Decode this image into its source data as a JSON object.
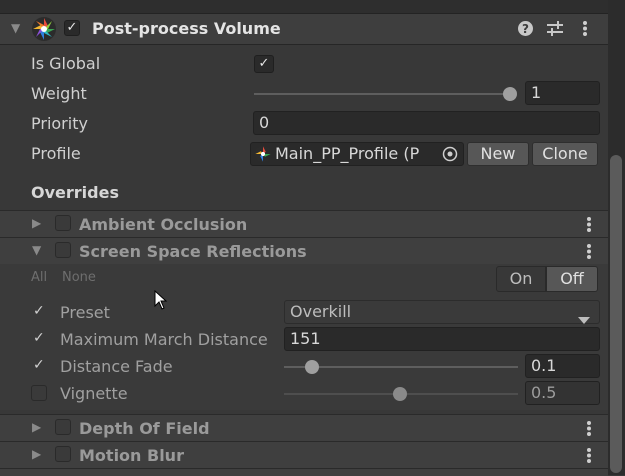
{
  "component": {
    "title": "Post-process Volume",
    "enabled": true,
    "fold_icon": "triangle-down-icon",
    "icon": "post-process-aperture-icon",
    "help_icon": "help-icon",
    "presets_icon": "sliders-icon",
    "menu_icon": "kebab-menu-icon"
  },
  "properties": {
    "is_global": {
      "label": "Is Global",
      "checked": true
    },
    "weight": {
      "label": "Weight",
      "value": "1",
      "level": 1.0
    },
    "priority": {
      "label": "Priority",
      "value": "0"
    },
    "profile": {
      "label": "Profile",
      "value": "Main_PP_Profile (P",
      "new_label": "New",
      "clone_label": "Clone"
    }
  },
  "overrides": {
    "heading": "Overrides",
    "effects": [
      {
        "name": "Ambient Occlusion",
        "expanded": false,
        "enabled": false
      },
      {
        "name": "Screen Space Reflections",
        "expanded": true,
        "enabled": false
      },
      {
        "name": "Depth Of Field",
        "expanded": false,
        "enabled": false
      },
      {
        "name": "Motion Blur",
        "expanded": false,
        "enabled": false
      }
    ]
  },
  "ssr": {
    "all_label": "All",
    "none_label": "None",
    "on_label": "On",
    "off_label": "Off",
    "preset": {
      "label": "Preset",
      "value": "Overkill",
      "override": true
    },
    "max_march": {
      "label": "Maximum March Distance",
      "value": "151",
      "override": true
    },
    "distance_fade": {
      "label": "Distance Fade",
      "value": "0.1",
      "override": true,
      "level": 0.1
    },
    "vignette": {
      "label": "Vignette",
      "value": "0.5",
      "override": false,
      "level": 0.5
    }
  },
  "colors": {
    "background": "#383838",
    "field": "#2a2a2a",
    "button": "#575757",
    "accent_selected": "#575757"
  }
}
